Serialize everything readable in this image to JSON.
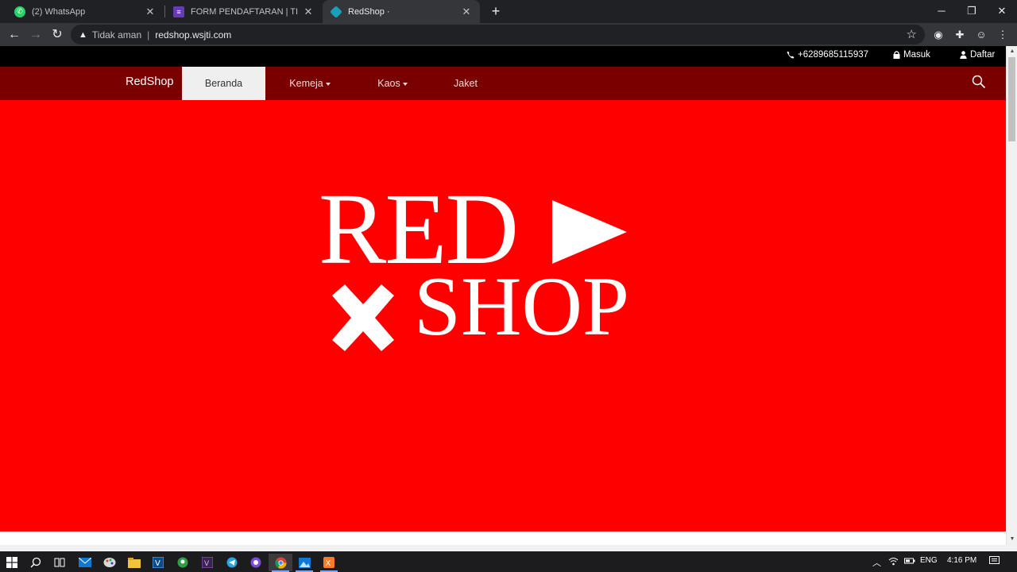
{
  "browser": {
    "tabs": [
      {
        "title": "(2) WhatsApp",
        "icon": "whatsapp-icon",
        "color": "#25d366"
      },
      {
        "title": "FORM PENDAFTARAN | TIF EXHIBIT",
        "icon": "forms-icon",
        "color": "#673ab7"
      },
      {
        "title": "RedShop ·",
        "icon": "redshop-tab-icon",
        "color": "#1aa0b8"
      }
    ],
    "close_glyph": "✕",
    "new_tab_glyph": "+",
    "security_label": "Tidak aman",
    "url": "redshop.wsjti.com"
  },
  "site": {
    "topbar": {
      "phone": "+6289685115937",
      "login": "Masuk",
      "register": "Daftar"
    },
    "brand": "RedShop",
    "nav": [
      {
        "label": "Beranda",
        "active": true,
        "dropdown": false
      },
      {
        "label": "Kemeja",
        "active": false,
        "dropdown": true
      },
      {
        "label": "Kaos",
        "active": false,
        "dropdown": true
      },
      {
        "label": "Jaket",
        "active": false,
        "dropdown": false
      }
    ],
    "hero": {
      "logo_line1": "RED",
      "logo_line2": "SHOP",
      "background": "#ff0000"
    },
    "colors": {
      "navbar": "#7a0000",
      "topbar": "#000000"
    }
  },
  "taskbar": {
    "language": "ENG",
    "time": "4:16 PM"
  }
}
